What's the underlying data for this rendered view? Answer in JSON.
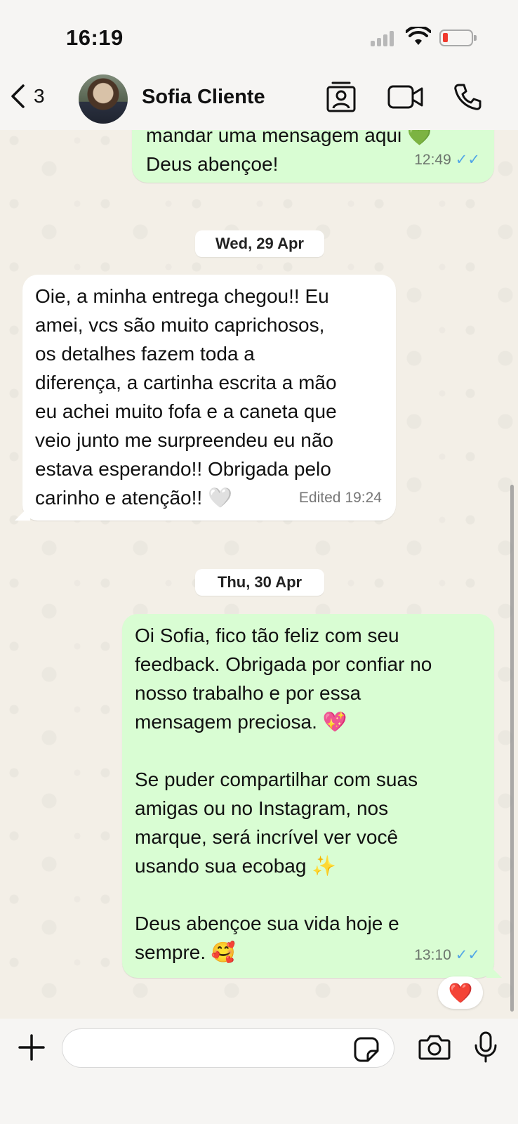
{
  "status_bar": {
    "time": "16:19"
  },
  "header": {
    "back_count": "3",
    "contact_name": "Sofia Cliente"
  },
  "messages": [
    {
      "direction": "out",
      "text": "mandar uma mensagem aqui 💚\nDeus abençoe!",
      "time": "12:49",
      "ticks": "✓✓"
    },
    {
      "type": "date",
      "label": "Wed, 29 Apr"
    },
    {
      "direction": "in",
      "text": "Oie, a minha entrega chegou!! Eu\namei, vcs são muito caprichosos,\nos detalhes fazem toda a\ndiferença, a cartinha escrita a mão\neu achei muito fofa e a caneta que\nveio junto me surpreendeu eu não\nestava esperando!! Obrigada pelo\ncarinho e atenção!! 🤍",
      "edited": "Edited",
      "time": "19:24"
    },
    {
      "type": "date",
      "label": "Thu, 30 Apr"
    },
    {
      "direction": "out",
      "text": "Oi Sofia, fico tão feliz com seu\nfeedback. Obrigada por confiar no\nnosso trabalho e por essa\nmensagem preciosa. 💖\n\nSe puder compartilhar com suas\namigas ou no Instagram, nos\nmarque, será incrível ver você\nusando sua ecobag ✨\n\nDeus abençoe sua vida hoje e\nsempre. 🥰",
      "time": "13:10",
      "ticks": "✓✓",
      "reaction": "❤️"
    }
  ],
  "input": {
    "placeholder": ""
  },
  "icons": {
    "back": "chevron-left-icon",
    "contact_card": "contact-card-icon",
    "video": "video-camera-icon",
    "phone": "phone-icon",
    "plus": "plus-icon",
    "sticker": "sticker-icon",
    "camera": "camera-icon",
    "mic": "microphone-icon"
  },
  "colors": {
    "outgoing_bubble": "#d9fdd3",
    "incoming_bubble": "#ffffff",
    "read_ticks": "#53a7e6",
    "battery_low": "#f03a2e"
  }
}
